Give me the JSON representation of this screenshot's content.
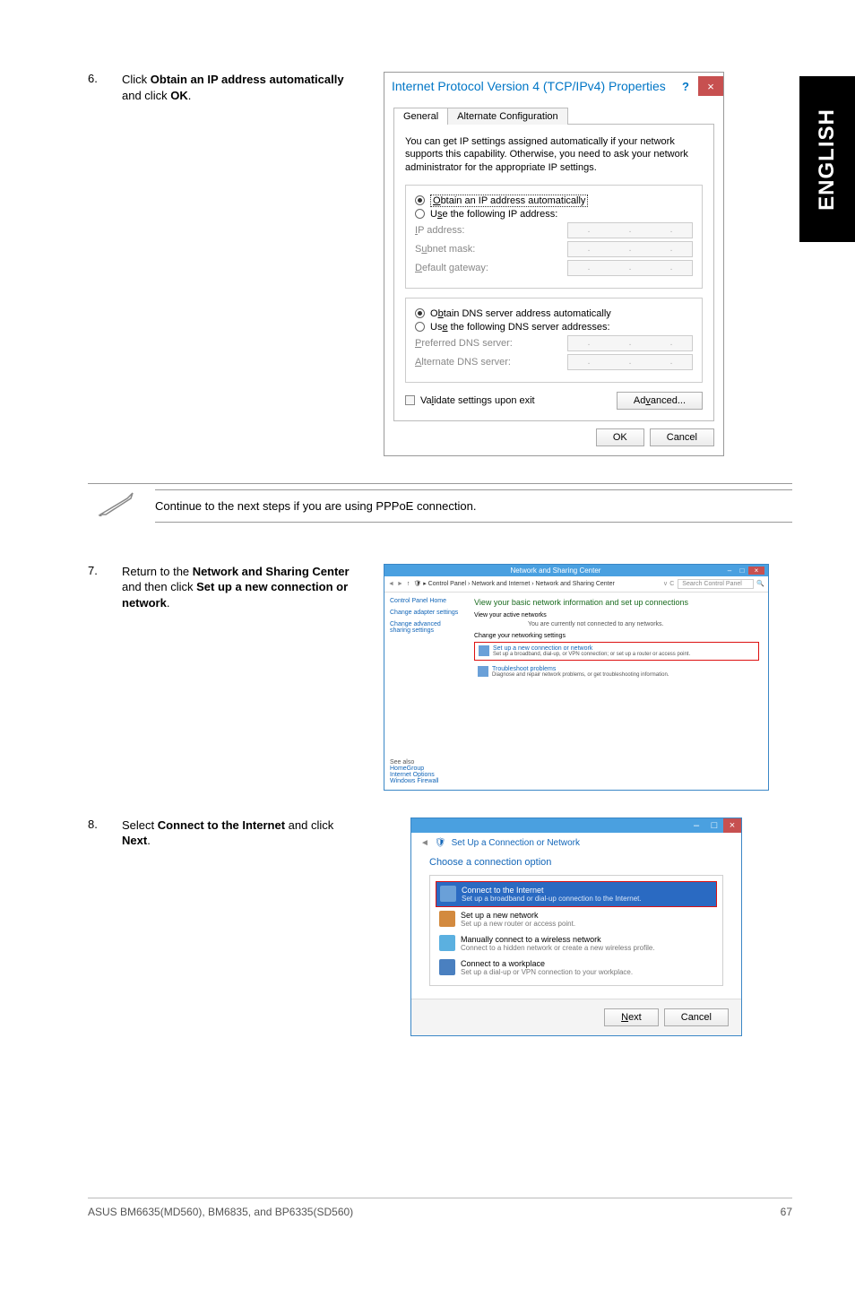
{
  "lang_tab": "ENGLISH",
  "step6": {
    "num": "6.",
    "text_pre": "Click ",
    "bold1": "Obtain an IP address automatically",
    "text_mid": " and click ",
    "bold2": "OK",
    "text_post": "."
  },
  "win1": {
    "title": "Internet Protocol Version 4 (TCP/IPv4) Properties",
    "help": "?",
    "close": "×",
    "tab_general": "General",
    "tab_alt": "Alternate Configuration",
    "desc": "You can get IP settings assigned automatically if your network supports this capability. Otherwise, you need to ask your network administrator for the appropriate IP settings.",
    "r_obtain_ip": "Obtain an IP address automatically",
    "r_use_ip": "Use the following IP address:",
    "f_ip": "IP address:",
    "f_mask": "Subnet mask:",
    "f_gw": "Default gateway:",
    "r_obtain_dns": "Obtain DNS server address automatically",
    "r_use_dns": "Use the following DNS server addresses:",
    "f_pdns": "Preferred DNS server:",
    "f_adns": "Alternate DNS server:",
    "validate": "Validate settings upon exit",
    "advanced": "Advanced...",
    "ok": "OK",
    "cancel": "Cancel"
  },
  "note": "Continue to the next steps if you are using PPPoE connection.",
  "step7": {
    "num": "7.",
    "text_pre": "Return to the ",
    "bold1": "Network and Sharing Center",
    "text_mid": " and then click ",
    "bold2": "Set up a new connection or network",
    "text_post": "."
  },
  "win2": {
    "title": "Network and Sharing Center",
    "breadcrumb": "Control Panel  ›  Network and Internet  ›  Network and Sharing Center",
    "search_ph": "Search Control Panel",
    "side_home": "Control Panel Home",
    "side_adapter": "Change adapter settings",
    "side_adv": "Change advanced sharing settings",
    "heading": "View your basic network information and set up connections",
    "view_active": "View your active networks",
    "not_connected": "You are currently not connected to any networks.",
    "change_net": "Change your networking settings",
    "setup_title": "Set up a new connection or network",
    "setup_sub": "Set up a broadband, dial-up, or VPN connection; or set up a router or access point.",
    "trouble_title": "Troubleshoot problems",
    "trouble_sub": "Diagnose and repair network problems, or get troubleshooting information.",
    "see_also": "See also",
    "homegroup": "HomeGroup",
    "inet_opts": "Internet Options",
    "wfw": "Windows Firewall"
  },
  "step8": {
    "num": "8.",
    "text_pre": "Select ",
    "bold1": "Connect to the Internet",
    "text_mid": " and click ",
    "bold2": "Next",
    "text_post": "."
  },
  "win3": {
    "subtitle": "Set Up a Connection or Network",
    "heading": "Choose a connection option",
    "opt1_t": "Connect to the Internet",
    "opt1_s": "Set up a broadband or dial-up connection to the Internet.",
    "opt2_t": "Set up a new network",
    "opt2_s": "Set up a new router or access point.",
    "opt3_t": "Manually connect to a wireless network",
    "opt3_s": "Connect to a hidden network or create a new wireless profile.",
    "opt4_t": "Connect to a workplace",
    "opt4_s": "Set up a dial-up or VPN connection to your workplace.",
    "next": "Next",
    "cancel": "Cancel"
  },
  "footer_left": "ASUS BM6635(MD560), BM6835, and BP6335(SD560)",
  "footer_right": "67"
}
